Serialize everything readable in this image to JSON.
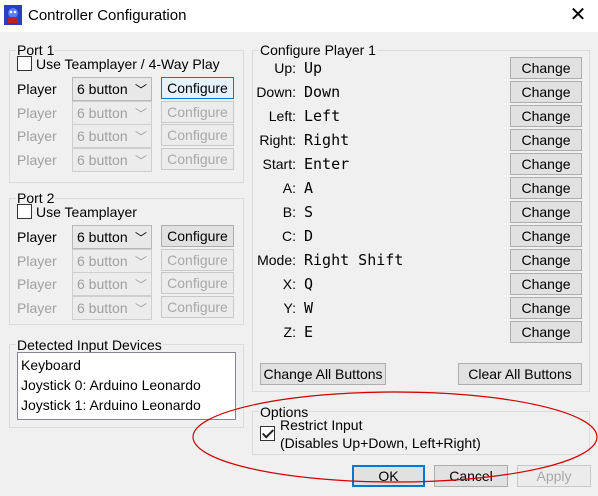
{
  "window": {
    "title": "Controller Configuration",
    "close_glyph": "✕"
  },
  "port1": {
    "legend": "Port 1",
    "teamplayer_label": "Use Teamplayer / 4-Way Play",
    "teamplayer_checked": false,
    "rows": [
      {
        "label": "Player",
        "value": "6 button",
        "button": "Configure",
        "enabled": true
      },
      {
        "label": "Player",
        "value": "6 button",
        "button": "Configure",
        "enabled": false
      },
      {
        "label": "Player",
        "value": "6 button",
        "button": "Configure",
        "enabled": false
      },
      {
        "label": "Player",
        "value": "6 button",
        "button": "Configure",
        "enabled": false
      }
    ]
  },
  "port2": {
    "legend": "Port 2",
    "teamplayer_label": "Use Teamplayer",
    "teamplayer_checked": false,
    "rows": [
      {
        "label": "Player",
        "value": "6 button",
        "button": "Configure",
        "enabled": true
      },
      {
        "label": "Player",
        "value": "6 button",
        "button": "Configure",
        "enabled": false
      },
      {
        "label": "Player",
        "value": "6 button",
        "button": "Configure",
        "enabled": false
      },
      {
        "label": "Player",
        "value": "6 button",
        "button": "Configure",
        "enabled": false
      }
    ]
  },
  "devices": {
    "legend": "Detected Input Devices",
    "items": [
      "Keyboard",
      "Joystick 0: Arduino Leonardo",
      "Joystick 1: Arduino Leonardo"
    ]
  },
  "configure": {
    "legend": "Configure Player 1",
    "change_label": "Change",
    "mappings": [
      {
        "label": "Up:",
        "key": "Up"
      },
      {
        "label": "Down:",
        "key": "Down"
      },
      {
        "label": "Left:",
        "key": "Left"
      },
      {
        "label": "Right:",
        "key": "Right"
      },
      {
        "label": "Start:",
        "key": "Enter"
      },
      {
        "label": "A:",
        "key": "A"
      },
      {
        "label": "B:",
        "key": "S"
      },
      {
        "label": "C:",
        "key": "D"
      },
      {
        "label": "Mode:",
        "key": "Right Shift"
      },
      {
        "label": "X:",
        "key": "Q"
      },
      {
        "label": "Y:",
        "key": "W"
      },
      {
        "label": "Z:",
        "key": "E"
      }
    ],
    "change_all_label": "Change All Buttons",
    "clear_all_label": "Clear All Buttons"
  },
  "options": {
    "legend": "Options",
    "restrict_label": "Restrict Input",
    "restrict_checked": true,
    "restrict_note": "(Disables Up+Down, Left+Right)"
  },
  "footer": {
    "ok_label": "OK",
    "cancel_label": "Cancel",
    "apply_label": "Apply"
  },
  "colors": {
    "annotation": "#d00000",
    "focus": "#0078d7"
  }
}
